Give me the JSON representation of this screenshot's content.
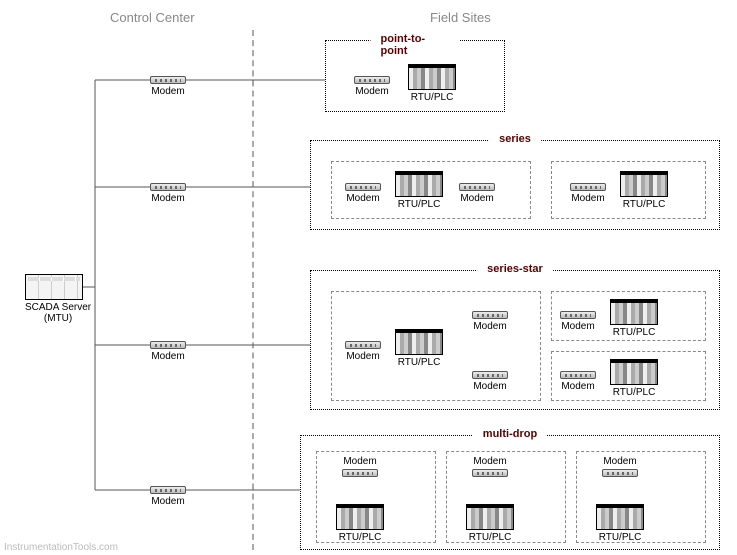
{
  "headers": {
    "control_center": "Control Center",
    "field_sites": "Field Sites"
  },
  "scada": {
    "label": "SCADA Server\n(MTU)"
  },
  "cc_modems": {
    "m1": "Modem",
    "m2": "Modem",
    "m3": "Modem",
    "m4": "Modem"
  },
  "topologies": {
    "ptp": {
      "title": "point-to-point",
      "nodes": {
        "modem": "Modem",
        "rtu": "RTU/PLC"
      }
    },
    "series": {
      "title": "series",
      "nodes": {
        "modem1": "Modem",
        "rtu1": "RTU/PLC",
        "modem2": "Modem",
        "modem3": "Modem",
        "rtu2": "RTU/PLC"
      }
    },
    "series_star": {
      "title": "series-star",
      "nodes": {
        "modem1": "Modem",
        "rtu1": "RTU/PLC",
        "modemT": "Modem",
        "modemT2": "Modem",
        "rtuT": "RTU/PLC",
        "modemB": "Modem",
        "modemB2": "Modem",
        "rtuB": "RTU/PLC"
      }
    },
    "multidrop": {
      "title": "multi-drop",
      "nodes": {
        "modem1": "Modem",
        "rtu1": "RTU/PLC",
        "modem2": "Modem",
        "rtu2": "RTU/PLC",
        "modem3": "Modem",
        "rtu3": "RTU/PLC"
      }
    }
  },
  "watermark": "InstrumentationTools.com"
}
